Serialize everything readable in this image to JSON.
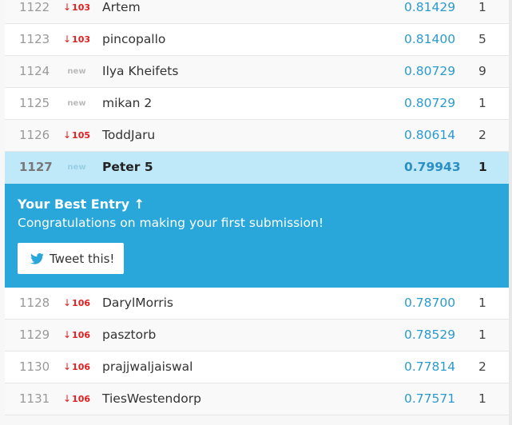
{
  "rows_before": [
    {
      "rank": "1122",
      "delta_arrow": "↓",
      "delta": "103",
      "delta_type": "down",
      "name": "Artem",
      "score": "0.81429",
      "entries": "1"
    },
    {
      "rank": "1123",
      "delta_arrow": "↓",
      "delta": "103",
      "delta_type": "down",
      "name": "pincopallo",
      "score": "0.81400",
      "entries": "5"
    },
    {
      "rank": "1124",
      "delta_arrow": "",
      "delta": "new",
      "delta_type": "new",
      "name": "Ilya Kheifets",
      "score": "0.80729",
      "entries": "9"
    },
    {
      "rank": "1125",
      "delta_arrow": "",
      "delta": "new",
      "delta_type": "new",
      "name": "mikan 2",
      "score": "0.80729",
      "entries": "1"
    },
    {
      "rank": "1126",
      "delta_arrow": "↓",
      "delta": "105",
      "delta_type": "down",
      "name": "ToddJaru",
      "score": "0.80614",
      "entries": "2"
    }
  ],
  "highlight_row": {
    "rank": "1127",
    "delta": "new",
    "name": "Peter 5",
    "score": "0.79943",
    "entries": "1"
  },
  "banner": {
    "title": "Your Best Entry ↑",
    "message": "Congratulations on making your first submission!",
    "tweet_label": "Tweet this!",
    "icon": "twitter-icon"
  },
  "rows_after": [
    {
      "rank": "1128",
      "delta_arrow": "↓",
      "delta": "106",
      "delta_type": "down",
      "name": "DarylMorris",
      "score": "0.78700",
      "entries": "1"
    },
    {
      "rank": "1129",
      "delta_arrow": "↓",
      "delta": "106",
      "delta_type": "down",
      "name": "pasztorb",
      "score": "0.78529",
      "entries": "1"
    },
    {
      "rank": "1130",
      "delta_arrow": "↓",
      "delta": "106",
      "delta_type": "down",
      "name": "prajjwaljaiswal",
      "score": "0.77814",
      "entries": "2"
    },
    {
      "rank": "1131",
      "delta_arrow": "↓",
      "delta": "106",
      "delta_type": "down",
      "name": "TiesWestendorp",
      "score": "0.77571",
      "entries": "1"
    }
  ],
  "colors": {
    "highlight_bg": "#bfe8f8",
    "banner_bg": "#2aa7da",
    "score_blue": "#2b9bcf",
    "rank_down_red": "#e02020"
  }
}
